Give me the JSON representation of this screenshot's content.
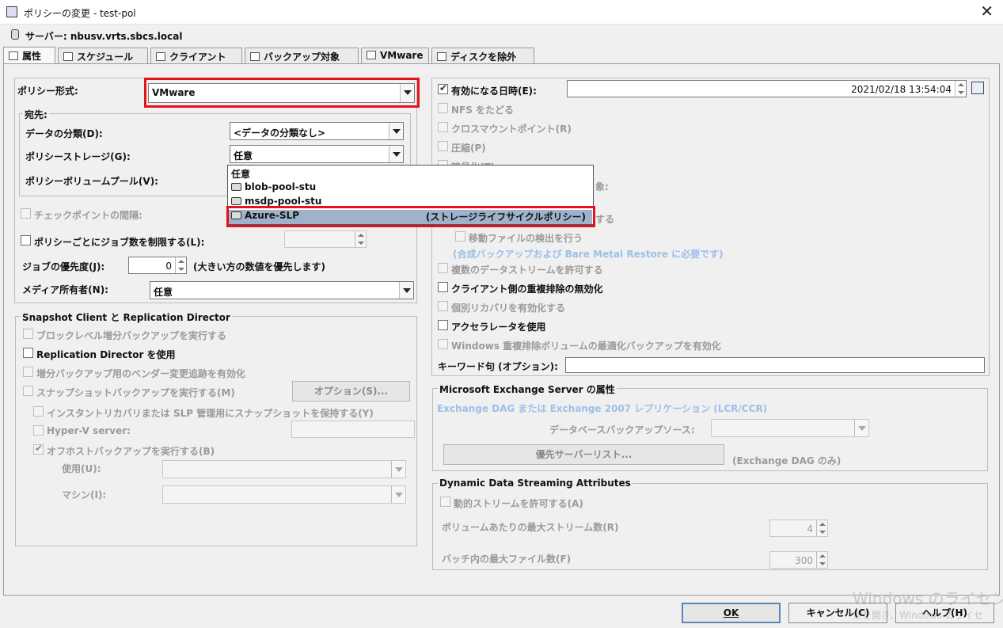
{
  "window": {
    "title": "ポリシーの変更 - test-pol",
    "close": "✕"
  },
  "server": {
    "label": "サーバー: nbusv.vrts.sbcs.local"
  },
  "tabs": [
    "属性",
    "スケジュール",
    "クライアント",
    "バックアップ対象",
    "VMware",
    "ディスクを除外"
  ],
  "left": {
    "policy_type_label": "ポリシー形式:",
    "policy_type_value": "VMware",
    "dest_group": "宛先:",
    "data_class_label": "データの分類(D):",
    "data_class_value": "<データの分類なし>",
    "policy_storage_label": "ポリシーストレージ(G):",
    "policy_storage_value": "任意",
    "volume_pool_label": "ポリシーボリュームプール(V):",
    "checkpoint_label": "チェックポイントの間隔:",
    "limit_jobs_label": "ポリシーごとにジョブ数を制限する(L):",
    "priority_label": "ジョブの優先度(J):",
    "priority_value": "0",
    "priority_hint": "(大きい方の数値を優先します)",
    "media_owner_label": "メディア所有者(N):",
    "media_owner_value": "任意"
  },
  "dropdown": {
    "items": [
      {
        "label": "任意",
        "note": ""
      },
      {
        "label": "blob-pool-stu",
        "note": ""
      },
      {
        "label": "msdp-pool-stu",
        "note": ""
      },
      {
        "label": "Azure-SLP",
        "note": "(ストレージライフサイクルポリシー)"
      }
    ]
  },
  "snapshot": {
    "title": "Snapshot Client と Replication Director",
    "block_level": "ブロックレベル増分バックアップを実行する",
    "replication_director": "Replication Director を使用",
    "vendor_tracking": "増分バックアップ用のベンダー変更追跡を有効化",
    "snapshot_backup": "スナップショットバックアップを実行する(M)",
    "options_button": "オプション(S)...",
    "instant_recovery": "インスタントリカバリまたは SLP 管理用にスナップショットを保持する(Y)",
    "hyperv": "Hyper-V server:",
    "offhost": "オフホストバックアップを実行する(B)",
    "use_label": "使用(U):",
    "machine_label": "マシン(I):"
  },
  "right": {
    "effective_label": "有効になる日時(E):",
    "effective_value": "2021/02/18 13:54:04",
    "follow_nfs": "NFS をたどる",
    "cross_mount": "クロスマウントポイント(R)",
    "compress": "圧縮(P)",
    "encrypt": "暗号化(T)",
    "collect_tail": "象:",
    "enable_tail": "する",
    "move_detect": "移動ファイルの検出を行う",
    "synthetic_note": "(合成バックアップおよび Bare Metal Restore に必要です)",
    "multi_stream": "複数のデータストリームを許可する",
    "client_dedup": "クライアント側の重複排除の無効化",
    "granular": "個別リカバリを有効化する",
    "accelerator": "アクセラレータを使用",
    "windows_dedup": "Windows 重複排除ボリュームの最適化バックアップを有効化",
    "keyword_label": "キーワード句 (オプション):"
  },
  "exchange": {
    "title": "Microsoft Exchange Server の属性",
    "dag_note": "Exchange DAG または Exchange 2007 レプリケーション (LCR/CCR)",
    "db_source_label": "データベースバックアップソース:",
    "preferred_button": "優先サーバーリスト...",
    "dag_only": "(Exchange DAG のみ)"
  },
  "dds": {
    "title": "Dynamic Data Streaming Attributes",
    "allow_dynamic": "動的ストリームを許可する(A)",
    "max_streams_label": "ボリュームあたりの最大ストリーム数(R)",
    "max_streams_value": "4",
    "max_files_label": "バッチ内の最大ファイル数(F)",
    "max_files_value": "300"
  },
  "buttons": {
    "ok": "OK",
    "cancel": "キャンセル(C)",
    "help": "ヘルプ(H)"
  },
  "watermark": {
    "line1": "Windows のライセンス認",
    "line2": "定を開き、Windows のライセ"
  }
}
